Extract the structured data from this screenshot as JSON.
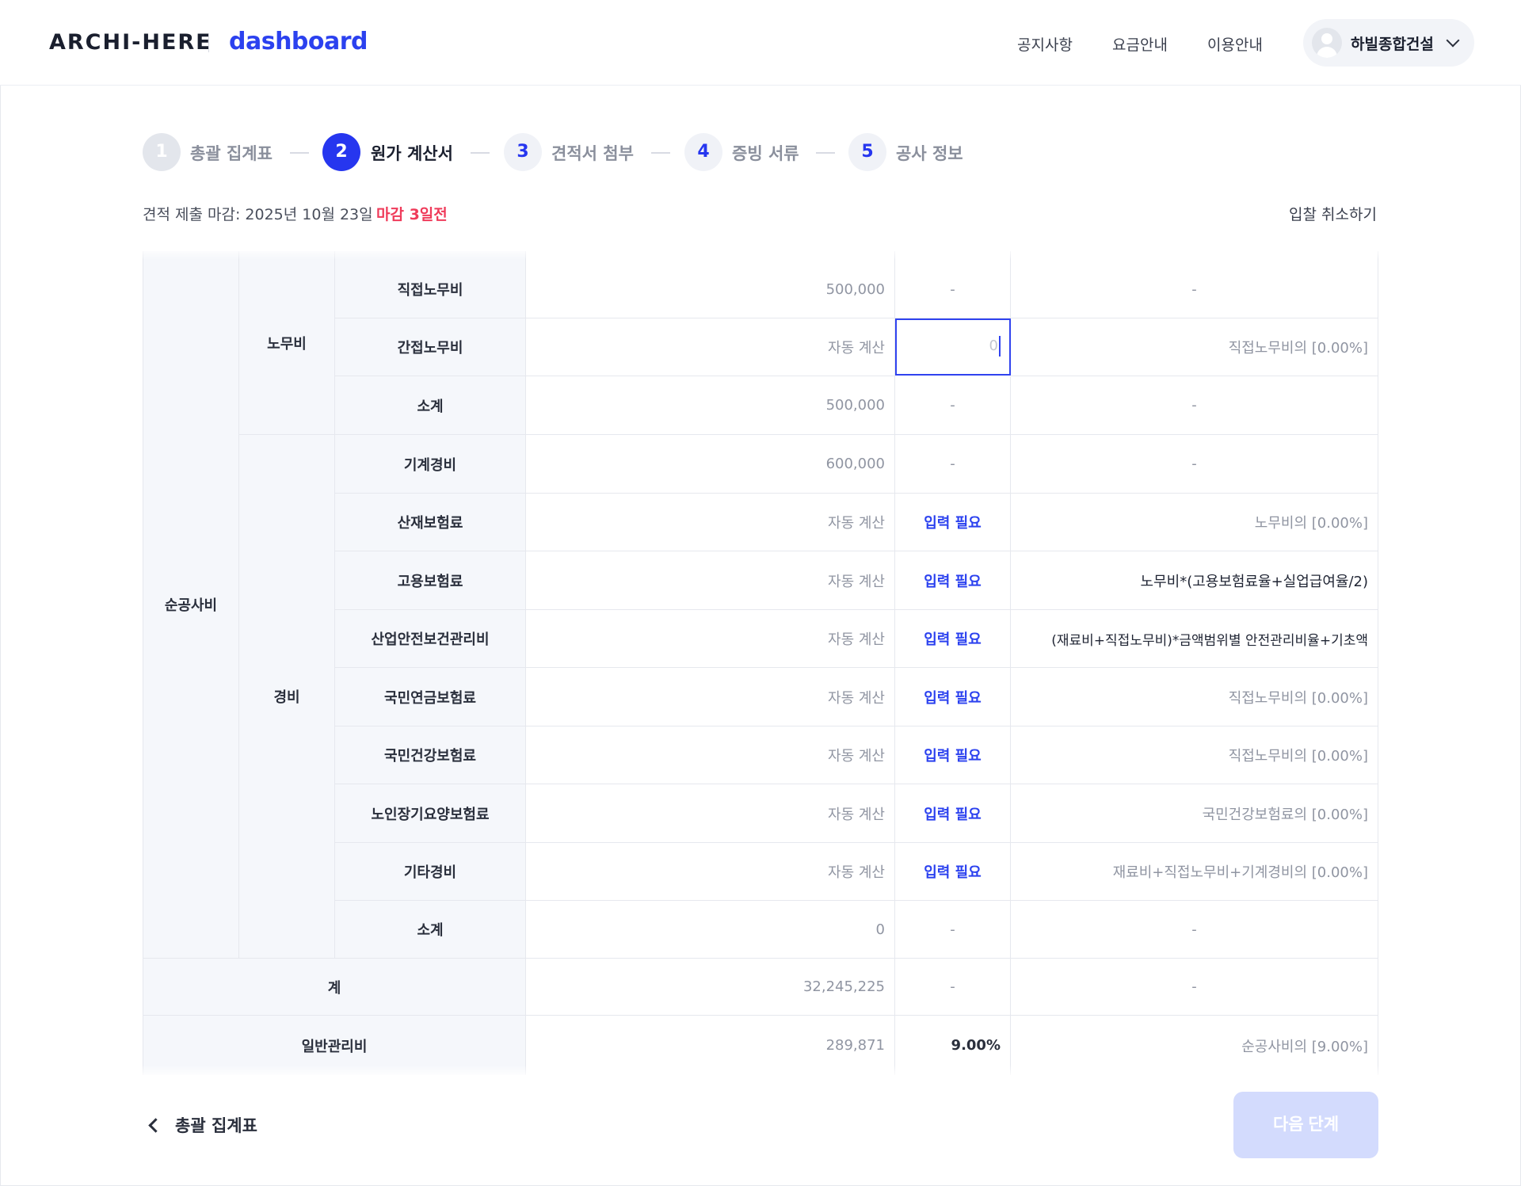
{
  "header": {
    "logo": "ARCHI-HERE",
    "product": "dashboard",
    "nav": [
      "공지사항",
      "요금안내",
      "이용안내"
    ],
    "user_name": "하빌종합건설"
  },
  "stepper": {
    "steps": [
      {
        "number": "1",
        "label": "총괄 집계표",
        "state": "done"
      },
      {
        "number": "2",
        "label": "원가 계산서",
        "state": "active"
      },
      {
        "number": "3",
        "label": "견적서 첨부",
        "state": "todo"
      },
      {
        "number": "4",
        "label": "증빙 서류",
        "state": "todo"
      },
      {
        "number": "5",
        "label": "공사 정보",
        "state": "todo"
      }
    ]
  },
  "deadline": {
    "text": "견적 제출 마감: 2025년 10월 23일",
    "badge": "마감 3일전",
    "cancel": "입찰 취소하기"
  },
  "table": {
    "group": "순공사비",
    "labor": {
      "label": "노무비",
      "rows": [
        {
          "item": "직접노무비",
          "amount": "500,000",
          "rate": "-",
          "note": "-"
        },
        {
          "item": "간접노무비",
          "amount": "자동 계산",
          "rate": "0",
          "note": "직접노무비의 [0.00%]"
        },
        {
          "item": "소계",
          "amount": "500,000",
          "rate": "-",
          "note": "-"
        }
      ]
    },
    "expense": {
      "label": "경비",
      "rows": [
        {
          "item": "기계경비",
          "amount": "600,000",
          "rate": "-",
          "note": "-"
        },
        {
          "item": "산재보험료",
          "amount": "자동 계산",
          "rate": "입력 필요",
          "note": "노무비의 [0.00%]"
        },
        {
          "item": "고용보험료",
          "amount": "자동 계산",
          "rate": "입력 필요",
          "note": "노무비*(고용보험료율+실업급여율/2)"
        },
        {
          "item": "산업안전보건관리비",
          "amount": "자동 계산",
          "rate": "입력 필요",
          "note": "(재료비+직접노무비)*금액범위별 안전관리비율+기초액"
        },
        {
          "item": "국민연금보험료",
          "amount": "자동 계산",
          "rate": "입력 필요",
          "note": "직접노무비의 [0.00%]"
        },
        {
          "item": "국민건강보험료",
          "amount": "자동 계산",
          "rate": "입력 필요",
          "note": "직접노무비의 [0.00%]"
        },
        {
          "item": "노인장기요양보험료",
          "amount": "자동 계산",
          "rate": "입력 필요",
          "note": "국민건강보험료의 [0.00%]"
        },
        {
          "item": "기타경비",
          "amount": "자동 계산",
          "rate": "입력 필요",
          "note": "재료비+직접노무비+기계경비의 [0.00%]"
        },
        {
          "item": "소계",
          "amount": "0",
          "rate": "-",
          "note": "-"
        }
      ]
    },
    "total": {
      "item": "계",
      "amount": "32,245,225",
      "rate": "-",
      "note": "-"
    },
    "general": {
      "item": "일반관리비",
      "amount": "289,871",
      "rate": "9.00%",
      "note": "순공사비의 [9.00%]"
    }
  },
  "footer": {
    "back_label": "총괄 집계표",
    "next_label": "다음 단계"
  },
  "colors": {
    "brand": "#2b41ef",
    "active_step": "#2636ef",
    "deadline_red": "#ef3b5a",
    "header_cell_bg": "#f5f7fb",
    "next_button_disabled": "#d3dbfd"
  }
}
